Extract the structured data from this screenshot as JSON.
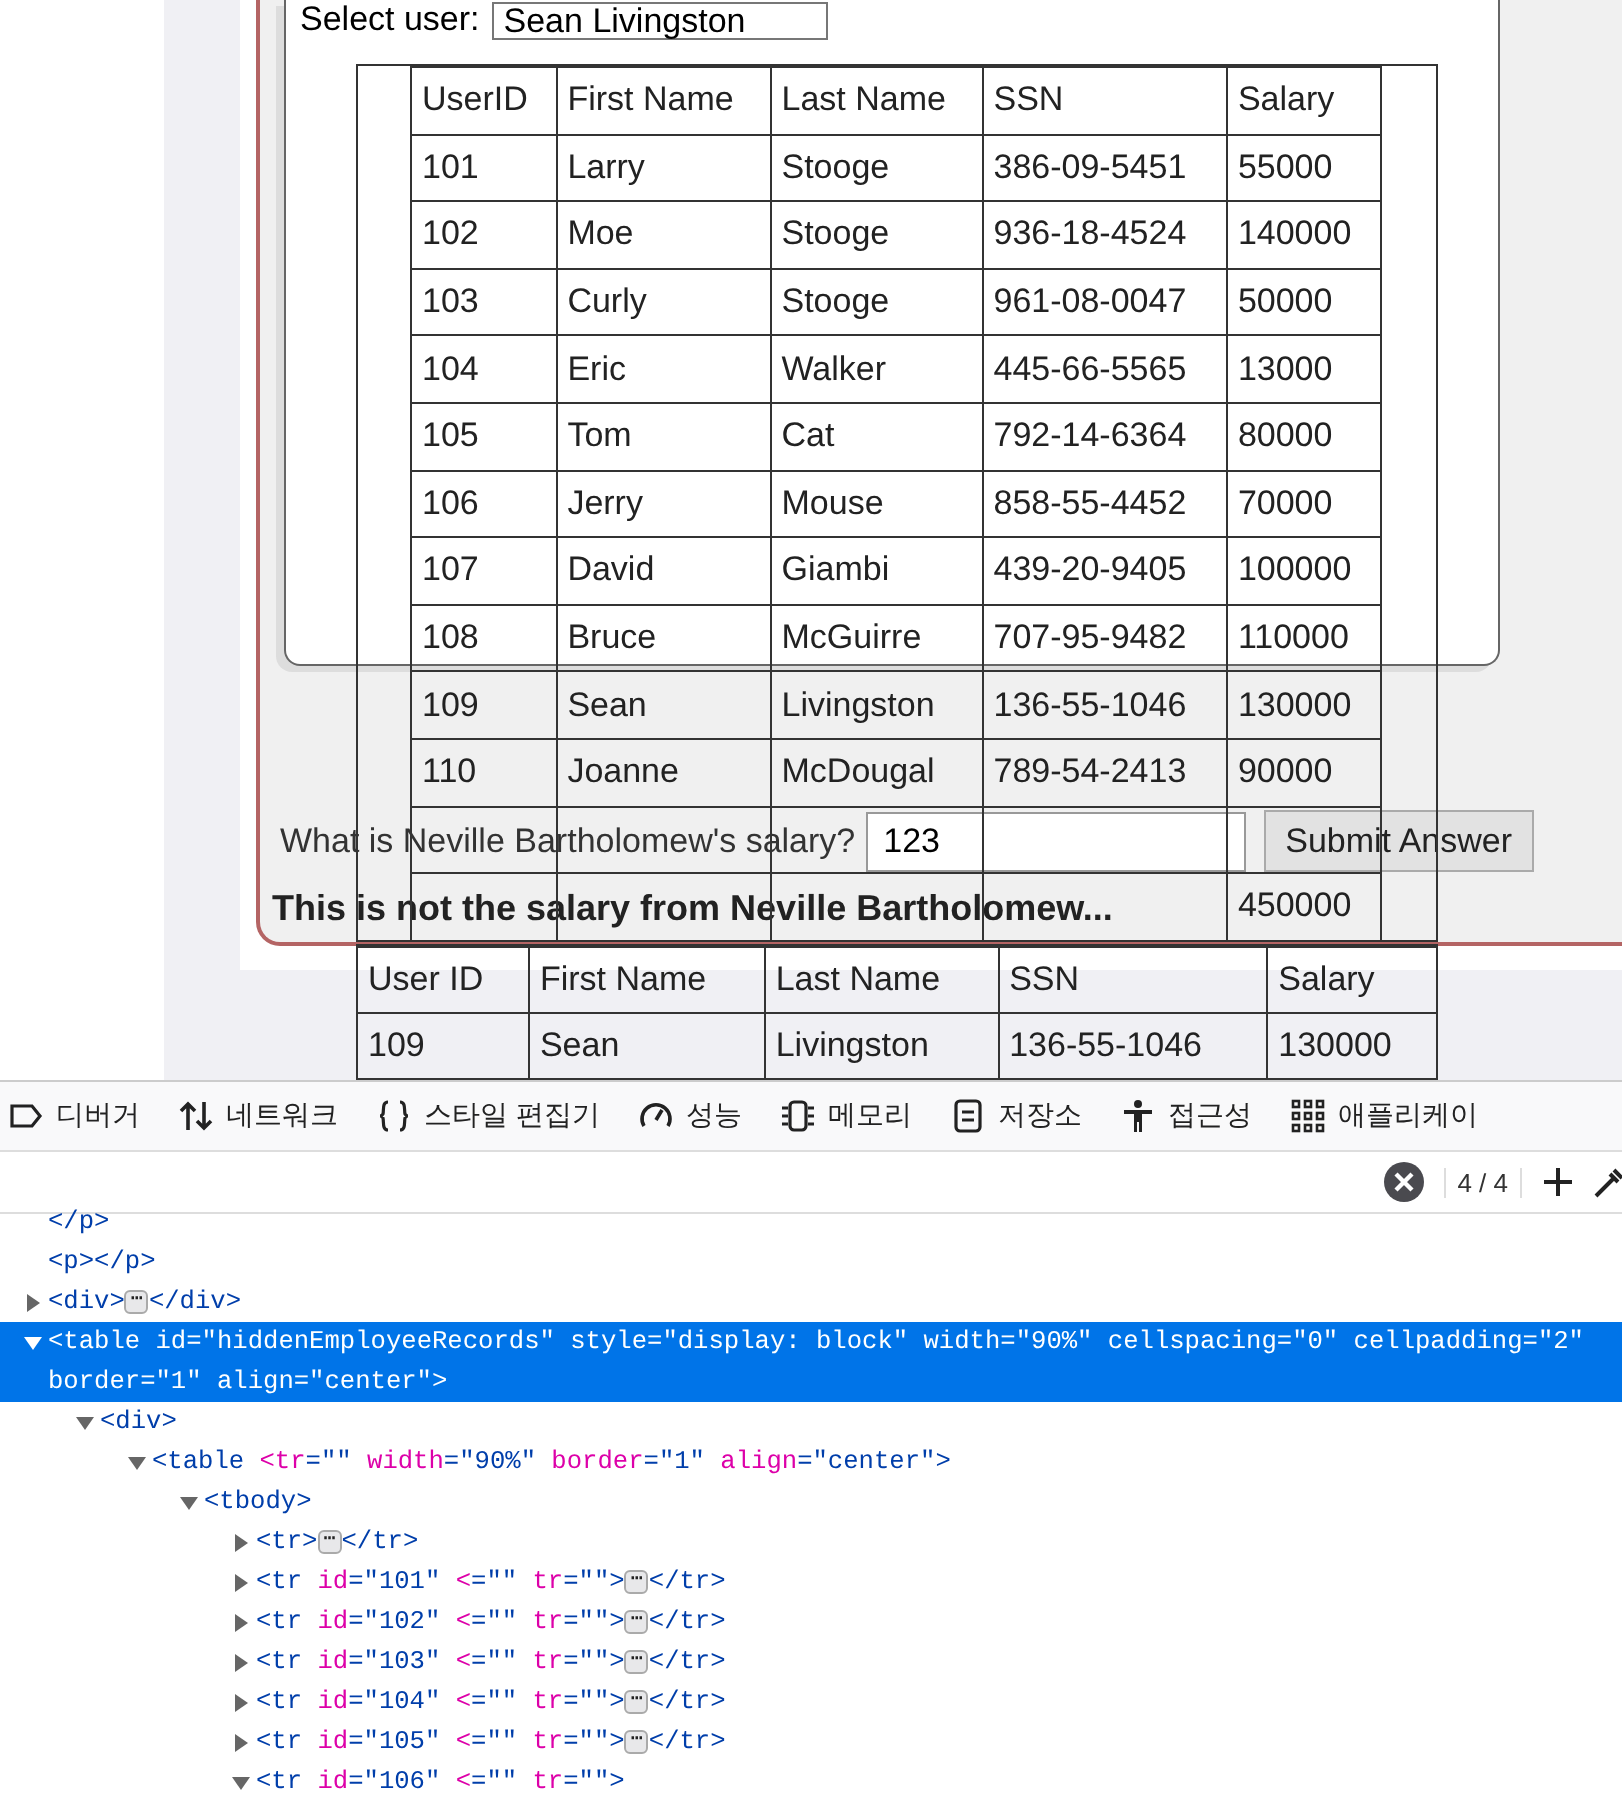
{
  "page": {
    "select_label": "Select user:",
    "select_value": "Sean Livingston",
    "records": {
      "columns": [
        "UserID",
        "First Name",
        "Last Name",
        "SSN",
        "Salary"
      ],
      "rows": [
        {
          "cells": [
            "101",
            "Larry",
            "Stooge",
            "386-09-5451",
            "55000"
          ]
        },
        {
          "cells": [
            "102",
            "Moe",
            "Stooge",
            "936-18-4524",
            "140000"
          ]
        },
        {
          "cells": [
            "103",
            "Curly",
            "Stooge",
            "961-08-0047",
            "50000"
          ]
        },
        {
          "cells": [
            "104",
            "Eric",
            "Walker",
            "445-66-5565",
            "13000"
          ]
        },
        {
          "cells": [
            "105",
            "Tom",
            "Cat",
            "792-14-6364",
            "80000"
          ]
        },
        {
          "cells": [
            "106",
            "Jerry",
            "Mouse",
            "858-55-4452",
            "70000"
          ]
        },
        {
          "cells": [
            "107",
            "David",
            "Giambi",
            "439-20-9405",
            "100000"
          ]
        },
        {
          "cells": [
            "108",
            "Bruce",
            "McGuirre",
            "707-95-9482",
            "110000"
          ]
        },
        {
          "cells": [
            "109",
            "Sean",
            "Livingston",
            "136-55-1046",
            "130000"
          ]
        },
        {
          "cells": [
            "110",
            "Joanne",
            "McDougal",
            "789-54-2413",
            "90000"
          ]
        },
        {
          "kind": "covered"
        },
        {
          "kind": "covered",
          "salary": "450000"
        }
      ]
    },
    "question": "What is Neville Bartholomew's salary?",
    "answer": {
      "value": "123"
    },
    "submit": "Submit Answer",
    "message": "This is not the salary from Neville Bartholomew...",
    "result": {
      "columns": [
        "User ID",
        "First Name",
        "Last Name",
        "SSN",
        "Salary"
      ],
      "rows": [
        {
          "cells": [
            "109",
            "Sean",
            "Livingston",
            "136-55-1046",
            "130000"
          ]
        }
      ]
    }
  },
  "devtools": {
    "tabs": [
      {
        "label": "디버거",
        "kind": "tag"
      },
      {
        "label": "네트워크",
        "kind": "arrows"
      },
      {
        "label": "스타일 편집기",
        "kind": "braces"
      },
      {
        "label": "성능",
        "kind": "gauge"
      },
      {
        "label": "메모리",
        "kind": "chip"
      },
      {
        "label": "저장소",
        "kind": "storage"
      },
      {
        "label": "접근성",
        "kind": "person"
      },
      {
        "label": "애플리케이",
        "kind": "grid"
      }
    ],
    "search": {
      "count": "4 / 4"
    },
    "tree": [
      {
        "selected": false,
        "parts": [
          {
            "kind": "tag",
            "text": "</p>"
          }
        ]
      },
      {
        "selected": false,
        "parts": [
          {
            "kind": "tag",
            "text": "<p></p>"
          }
        ]
      },
      {
        "selected": false,
        "expanded": false,
        "parts": [
          {
            "kind": "tag",
            "text": "<div>"
          },
          {
            "kind": "badge",
            "text": "⋯"
          },
          {
            "kind": "tag",
            "text": "</div>"
          }
        ]
      },
      {
        "selected": true,
        "expanded": true,
        "parts": [
          {
            "kind": "tag",
            "text": "<table"
          },
          {
            "kind": "attr",
            "text": " id"
          },
          {
            "kind": "value",
            "text": "=\"hiddenEmployeeRecords\""
          },
          {
            "kind": "attr",
            "text": " style"
          },
          {
            "kind": "value",
            "text": "=\"display: block\""
          },
          {
            "kind": "attr",
            "text": " width"
          },
          {
            "kind": "value",
            "text": "=\"90%\""
          },
          {
            "kind": "attr",
            "text": " cellspacing"
          },
          {
            "kind": "value",
            "text": "=\"0\""
          },
          {
            "kind": "attr",
            "text": " cellpadding"
          },
          {
            "kind": "value",
            "text": "=\"2\""
          },
          {
            "kind": "attr",
            "text": " border"
          },
          {
            "kind": "value",
            "text": "=\"1\""
          },
          {
            "kind": "attr",
            "text": " align"
          },
          {
            "kind": "value",
            "text": "=\"center\""
          },
          {
            "kind": "tag",
            "text": ">"
          }
        ],
        "children": [
          {
            "selected": false,
            "expanded": true,
            "parts": [
              {
                "kind": "tag",
                "text": "<div>"
              }
            ],
            "children": [
              {
                "selected": false,
                "expanded": true,
                "parts": [
                  {
                    "kind": "tag",
                    "text": "<table"
                  },
                  {
                    "kind": "attr",
                    "text": " <tr"
                  },
                  {
                    "kind": "value",
                    "text": "=\"\""
                  },
                  {
                    "kind": "attr",
                    "text": " width"
                  },
                  {
                    "kind": "value",
                    "text": "=\"90%\""
                  },
                  {
                    "kind": "attr",
                    "text": " border"
                  },
                  {
                    "kind": "value",
                    "text": "=\"1\""
                  },
                  {
                    "kind": "attr",
                    "text": " align"
                  },
                  {
                    "kind": "value",
                    "text": "=\"center\""
                  },
                  {
                    "kind": "tag",
                    "text": ">"
                  }
                ],
                "children": [
                  {
                    "selected": false,
                    "expanded": true,
                    "parts": [
                      {
                        "kind": "tag",
                        "text": "<tbody>"
                      }
                    ],
                    "children": [
                      {
                        "selected": false,
                        "expanded": false,
                        "parts": [
                          {
                            "kind": "tag",
                            "text": "<tr>"
                          },
                          {
                            "kind": "badge",
                            "text": "⋯"
                          },
                          {
                            "kind": "tag",
                            "text": "</tr>"
                          }
                        ]
                      },
                      {
                        "selected": false,
                        "expanded": false,
                        "parts": [
                          {
                            "kind": "tag",
                            "text": "<tr"
                          },
                          {
                            "kind": "attr",
                            "text": " id"
                          },
                          {
                            "kind": "value",
                            "text": "=\"101\""
                          },
                          {
                            "kind": "attr",
                            "text": " <"
                          },
                          {
                            "kind": "value",
                            "text": "=\"\""
                          },
                          {
                            "kind": "attr",
                            "text": " tr"
                          },
                          {
                            "kind": "value",
                            "text": "=\"\""
                          },
                          {
                            "kind": "tag",
                            "text": ">"
                          },
                          {
                            "kind": "badge",
                            "text": "⋯"
                          },
                          {
                            "kind": "tag",
                            "text": "</tr>"
                          }
                        ]
                      },
                      {
                        "selected": false,
                        "expanded": false,
                        "parts": [
                          {
                            "kind": "tag",
                            "text": "<tr"
                          },
                          {
                            "kind": "attr",
                            "text": " id"
                          },
                          {
                            "kind": "value",
                            "text": "=\"102\""
                          },
                          {
                            "kind": "attr",
                            "text": " <"
                          },
                          {
                            "kind": "value",
                            "text": "=\"\""
                          },
                          {
                            "kind": "attr",
                            "text": " tr"
                          },
                          {
                            "kind": "value",
                            "text": "=\"\""
                          },
                          {
                            "kind": "tag",
                            "text": ">"
                          },
                          {
                            "kind": "badge",
                            "text": "⋯"
                          },
                          {
                            "kind": "tag",
                            "text": "</tr>"
                          }
                        ]
                      },
                      {
                        "selected": false,
                        "expanded": false,
                        "parts": [
                          {
                            "kind": "tag",
                            "text": "<tr"
                          },
                          {
                            "kind": "attr",
                            "text": " id"
                          },
                          {
                            "kind": "value",
                            "text": "=\"103\""
                          },
                          {
                            "kind": "attr",
                            "text": " <"
                          },
                          {
                            "kind": "value",
                            "text": "=\"\""
                          },
                          {
                            "kind": "attr",
                            "text": " tr"
                          },
                          {
                            "kind": "value",
                            "text": "=\"\""
                          },
                          {
                            "kind": "tag",
                            "text": ">"
                          },
                          {
                            "kind": "badge",
                            "text": "⋯"
                          },
                          {
                            "kind": "tag",
                            "text": "</tr>"
                          }
                        ]
                      },
                      {
                        "selected": false,
                        "expanded": false,
                        "parts": [
                          {
                            "kind": "tag",
                            "text": "<tr"
                          },
                          {
                            "kind": "attr",
                            "text": " id"
                          },
                          {
                            "kind": "value",
                            "text": "=\"104\""
                          },
                          {
                            "kind": "attr",
                            "text": " <"
                          },
                          {
                            "kind": "value",
                            "text": "=\"\""
                          },
                          {
                            "kind": "attr",
                            "text": " tr"
                          },
                          {
                            "kind": "value",
                            "text": "=\"\""
                          },
                          {
                            "kind": "tag",
                            "text": ">"
                          },
                          {
                            "kind": "badge",
                            "text": "⋯"
                          },
                          {
                            "kind": "tag",
                            "text": "</tr>"
                          }
                        ]
                      },
                      {
                        "selected": false,
                        "expanded": false,
                        "parts": [
                          {
                            "kind": "tag",
                            "text": "<tr"
                          },
                          {
                            "kind": "attr",
                            "text": " id"
                          },
                          {
                            "kind": "value",
                            "text": "=\"105\""
                          },
                          {
                            "kind": "attr",
                            "text": " <"
                          },
                          {
                            "kind": "value",
                            "text": "=\"\""
                          },
                          {
                            "kind": "attr",
                            "text": " tr"
                          },
                          {
                            "kind": "value",
                            "text": "=\"\""
                          },
                          {
                            "kind": "tag",
                            "text": ">"
                          },
                          {
                            "kind": "badge",
                            "text": "⋯"
                          },
                          {
                            "kind": "tag",
                            "text": "</tr>"
                          }
                        ]
                      },
                      {
                        "selected": false,
                        "expanded": true,
                        "parts": [
                          {
                            "kind": "tag",
                            "text": "<tr"
                          },
                          {
                            "kind": "attr",
                            "text": " id"
                          },
                          {
                            "kind": "value",
                            "text": "=\"106\""
                          },
                          {
                            "kind": "attr",
                            "text": " <"
                          },
                          {
                            "kind": "value",
                            "text": "=\"\""
                          },
                          {
                            "kind": "attr",
                            "text": " tr"
                          },
                          {
                            "kind": "value",
                            "text": "=\"\""
                          },
                          {
                            "kind": "tag",
                            "text": ">"
                          }
                        ]
                      }
                    ]
                  }
                ]
              }
            ]
          }
        ]
      }
    ]
  }
}
